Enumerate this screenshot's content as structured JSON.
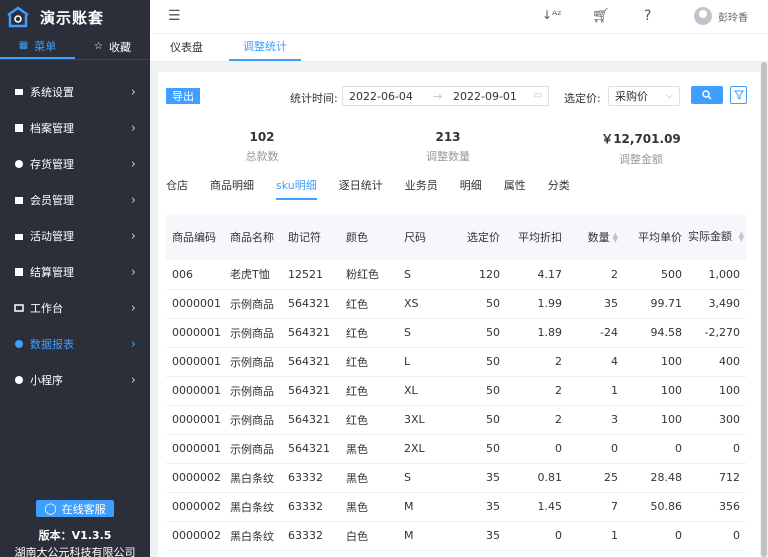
{
  "app": {
    "title": "演示账套"
  },
  "sidebar": {
    "tabs": [
      {
        "label": "菜单",
        "icon": "grid-icon"
      },
      {
        "label": "收藏",
        "icon": "star-icon"
      }
    ],
    "items": [
      {
        "label": "系统设置",
        "icon": "settings-icon"
      },
      {
        "label": "档案管理",
        "icon": "archive-icon"
      },
      {
        "label": "存货管理",
        "icon": "inventory-icon"
      },
      {
        "label": "会员管理",
        "icon": "member-icon"
      },
      {
        "label": "活动管理",
        "icon": "activity-icon"
      },
      {
        "label": "结算管理",
        "icon": "settlement-icon"
      },
      {
        "label": "工作台",
        "icon": "workbench-icon"
      },
      {
        "label": "数据报表",
        "icon": "report-icon",
        "active": true
      },
      {
        "label": "小程序",
        "icon": "miniapp-icon"
      }
    ],
    "service": "在线客服",
    "version": "版本：V1.3.5",
    "company": "湖南大公元科技有限公司"
  },
  "header": {
    "user_name": "彭玲香"
  },
  "page_tabs": [
    "仪表盘",
    "调整统计"
  ],
  "filter": {
    "export": "导出",
    "time_label": "统计时间:",
    "date_start": "2022-06-04",
    "date_end": "2022-09-01",
    "price_label": "选定价:",
    "price_value": "采购价"
  },
  "stats": [
    {
      "value": "102",
      "label": "总款数"
    },
    {
      "value": "213",
      "label": "调整数量"
    },
    {
      "value": "￥12,701.09",
      "label": "调整金额"
    }
  ],
  "sub_tabs": [
    "仓店",
    "商品明细",
    "sku明细",
    "逐日统计",
    "业务员",
    "明细",
    "属性",
    "分类"
  ],
  "table": {
    "headers": [
      "商品编码",
      "商品名称",
      "助记符",
      "颜色",
      "尺码",
      "选定价",
      "平均折扣",
      "数量",
      "平均单价",
      "实际金额"
    ],
    "rows": [
      [
        "006",
        "老虎T恤",
        "12521",
        "粉红色",
        "S",
        "120",
        "4.17",
        "2",
        "500",
        "1,000"
      ],
      [
        "0000001",
        "示例商品",
        "564321",
        "红色",
        "XS",
        "50",
        "1.99",
        "35",
        "99.71",
        "3,490"
      ],
      [
        "0000001",
        "示例商品",
        "564321",
        "红色",
        "S",
        "50",
        "1.89",
        "-24",
        "94.58",
        "-2,270"
      ],
      [
        "0000001",
        "示例商品",
        "564321",
        "红色",
        "L",
        "50",
        "2",
        "4",
        "100",
        "400"
      ],
      [
        "0000001",
        "示例商品",
        "564321",
        "红色",
        "XL",
        "50",
        "2",
        "1",
        "100",
        "100"
      ],
      [
        "0000001",
        "示例商品",
        "564321",
        "红色",
        "3XL",
        "50",
        "2",
        "3",
        "100",
        "300"
      ],
      [
        "0000001",
        "示例商品",
        "564321",
        "黑色",
        "2XL",
        "50",
        "0",
        "0",
        "0",
        "0"
      ],
      [
        "0000002",
        "黑白条纹",
        "63332",
        "黑色",
        "S",
        "35",
        "0.81",
        "25",
        "28.48",
        "712"
      ],
      [
        "0000002",
        "黑白条纹",
        "63332",
        "黑色",
        "M",
        "35",
        "1.45",
        "7",
        "50.86",
        "356"
      ],
      [
        "0000002",
        "黑白条纹",
        "63332",
        "白色",
        "M",
        "35",
        "0",
        "1",
        "0",
        "0"
      ]
    ]
  },
  "colors": {
    "accent": "#409eff",
    "sidebar_bg": "#2b2f3a"
  }
}
